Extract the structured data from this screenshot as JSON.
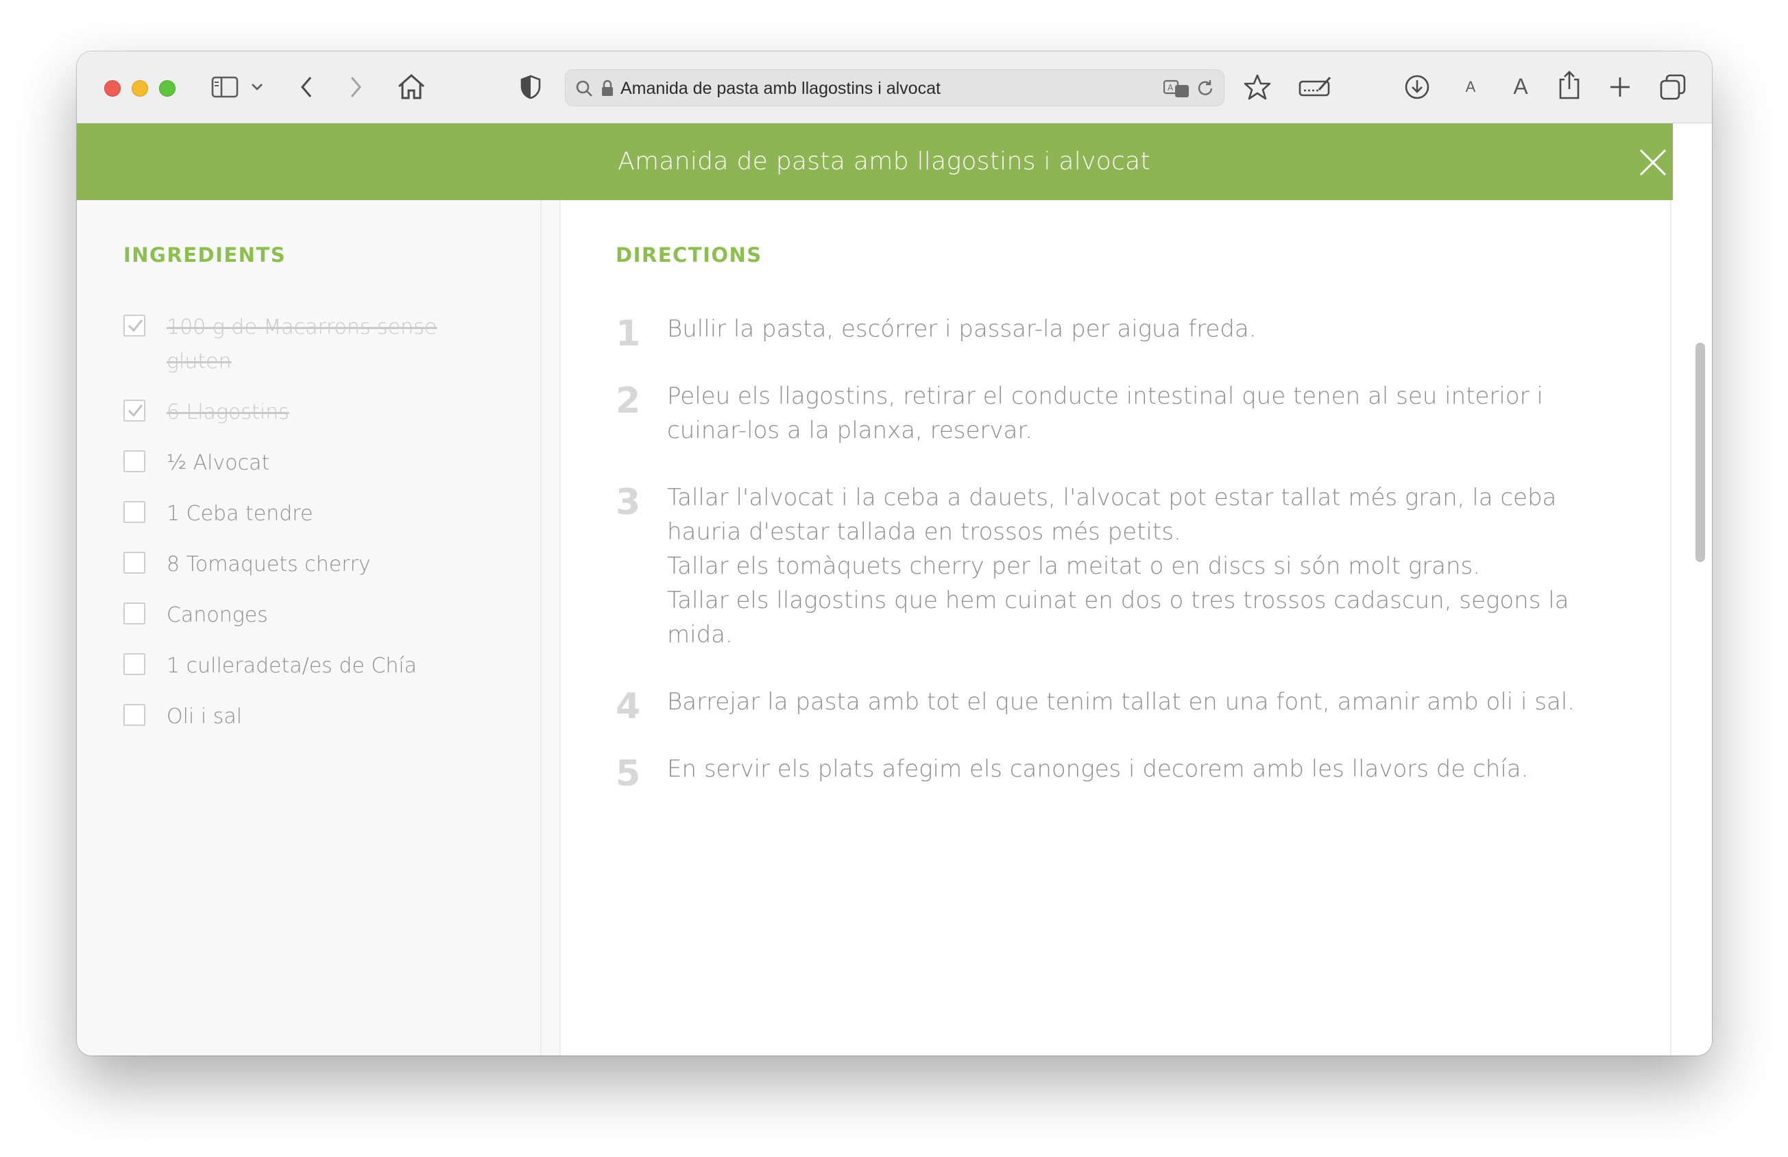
{
  "browser": {
    "url_display": "Amanida de pasta amb llagostins i alvocat",
    "font_small_label": "A",
    "font_large_label": "A",
    "icons": [
      "sidebar-icon",
      "chevron-down-icon",
      "back-icon",
      "forward-icon",
      "home-icon",
      "shield-icon",
      "search-icon",
      "lock-icon",
      "translate-icon",
      "reload-icon",
      "star-icon",
      "edit-icon",
      "download-icon",
      "share-icon",
      "plus-icon",
      "tabs-icon"
    ]
  },
  "recipe": {
    "title": "Amanida de pasta amb llagostins i alvocat",
    "accent_color": "#8db553"
  },
  "ingredients": {
    "heading": "INGREDIENTS",
    "items": [
      {
        "text": "100 g de Macarrons sense gluten",
        "checked": true
      },
      {
        "text": "6 Llagostins",
        "checked": true
      },
      {
        "text": "½ Alvocat",
        "checked": false
      },
      {
        "text": "1 Ceba tendre",
        "checked": false
      },
      {
        "text": "8 Tomaquets cherry",
        "checked": false
      },
      {
        "text": "Canonges",
        "checked": false
      },
      {
        "text": "1 culleradeta/es de Chía",
        "checked": false
      },
      {
        "text": "Oli i sal",
        "checked": false
      }
    ]
  },
  "directions": {
    "heading": "DIRECTIONS",
    "steps": [
      {
        "num": "1",
        "text": "Bullir la pasta, escórrer i passar-la per aigua freda."
      },
      {
        "num": "2",
        "text": "Peleu els llagostins, retirar el conducte intestinal que tenen al seu interior i cuinar-los a la planxa, reservar."
      },
      {
        "num": "3",
        "text": "Tallar l'alvocat i la ceba a dauets, l'alvocat pot estar tallat més gran, la ceba hauria d'estar tallada en trossos més petits.\nTallar els tomàquets cherry per la meitat o en discs si són molt grans.\nTallar els llagostins que hem cuinat en dos o tres trossos cadascun, segons la mida."
      },
      {
        "num": "4",
        "text": "Barrejar la pasta amb tot el que tenim tallat en una font, amanir amb oli i sal."
      },
      {
        "num": "5",
        "text": "En servir els plats afegim els canonges i decorem amb les llavors de chía."
      }
    ]
  }
}
